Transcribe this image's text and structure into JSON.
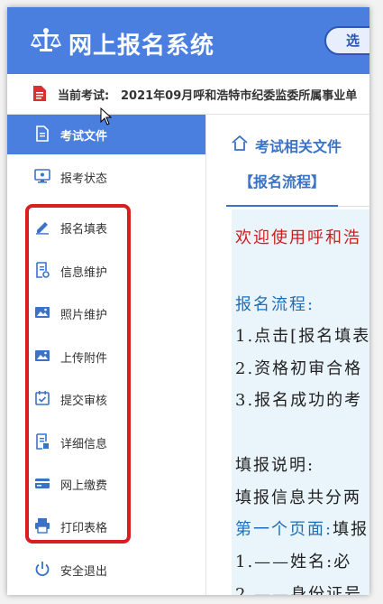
{
  "header": {
    "title": "网上报名系统",
    "select_label": "选"
  },
  "current_exam": {
    "label": "当前考试:",
    "value": "2021年09月呼和浩特市纪委监委所属事业单"
  },
  "sidebar": {
    "items": [
      {
        "label": "考试文件",
        "icon": "file-icon"
      },
      {
        "label": "报考状态",
        "icon": "monitor-icon"
      },
      {
        "label": "报名填表",
        "icon": "pencil-icon"
      },
      {
        "label": "信息维护",
        "icon": "document-edit-icon"
      },
      {
        "label": "照片维护",
        "icon": "image-icon"
      },
      {
        "label": "上传附件",
        "icon": "image-icon"
      },
      {
        "label": "提交审核",
        "icon": "calendar-check-icon"
      },
      {
        "label": "详细信息",
        "icon": "document-detail-icon"
      },
      {
        "label": "网上缴费",
        "icon": "card-icon"
      },
      {
        "label": "打印表格",
        "icon": "printer-icon"
      },
      {
        "label": "安全退出",
        "icon": "power-icon"
      }
    ]
  },
  "content": {
    "crumb": "考试相关文件",
    "tab": "【报名流程】",
    "lines": [
      "欢迎使用呼和浩",
      "报名流程:",
      "1.点击[报名填表",
      "2.资格初审合格",
      "3.报名成功的考",
      "填报说明:",
      "填报信息共分两",
      "第一个页面:",
      "填报",
      "1.——姓名:",
      "必",
      "2.——身份证号"
    ]
  },
  "colors": {
    "primary": "#4a7fe0",
    "highlight_border": "#d81e1e",
    "link_blue": "#3a73c6",
    "red_text": "#c81f1f"
  }
}
